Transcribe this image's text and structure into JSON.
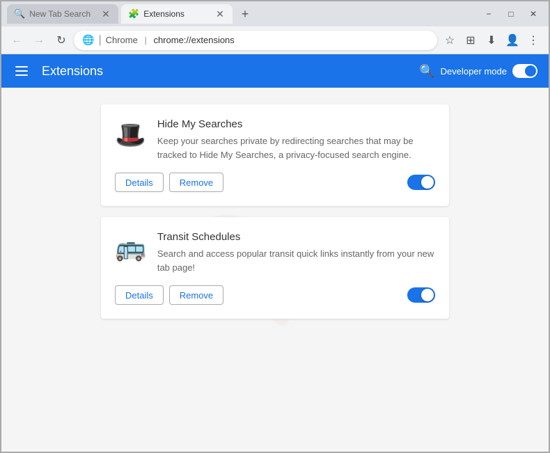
{
  "browser": {
    "tabs": [
      {
        "id": "tab-new-tab-search",
        "label": "New Tab Search",
        "icon": "🔍",
        "active": false
      },
      {
        "id": "tab-extensions",
        "label": "Extensions",
        "icon": "🧩",
        "active": true
      }
    ],
    "new_tab_label": "+",
    "address": {
      "chrome_icon": "🌐",
      "separator": "|",
      "prefix": "Chrome",
      "url": "chrome://extensions"
    },
    "window_controls": {
      "minimize": "−",
      "maximize": "□",
      "close": "✕"
    }
  },
  "extensions_header": {
    "title": "Extensions",
    "search_icon": "🔍",
    "developer_mode_label": "Developer mode"
  },
  "extensions": [
    {
      "id": "hide-my-searches",
      "name": "Hide My Searches",
      "description": "Keep your searches private by redirecting searches that may be tracked to Hide My Searches, a privacy-focused search engine.",
      "icon": "🎩",
      "details_label": "Details",
      "remove_label": "Remove",
      "enabled": true
    },
    {
      "id": "transit-schedules",
      "name": "Transit Schedules",
      "description": "Search and access popular transit quick links instantly from your new tab page!",
      "icon": "🚌",
      "details_label": "Details",
      "remove_label": "Remove",
      "enabled": true
    }
  ],
  "watermark": {
    "text": "fishan.com"
  }
}
